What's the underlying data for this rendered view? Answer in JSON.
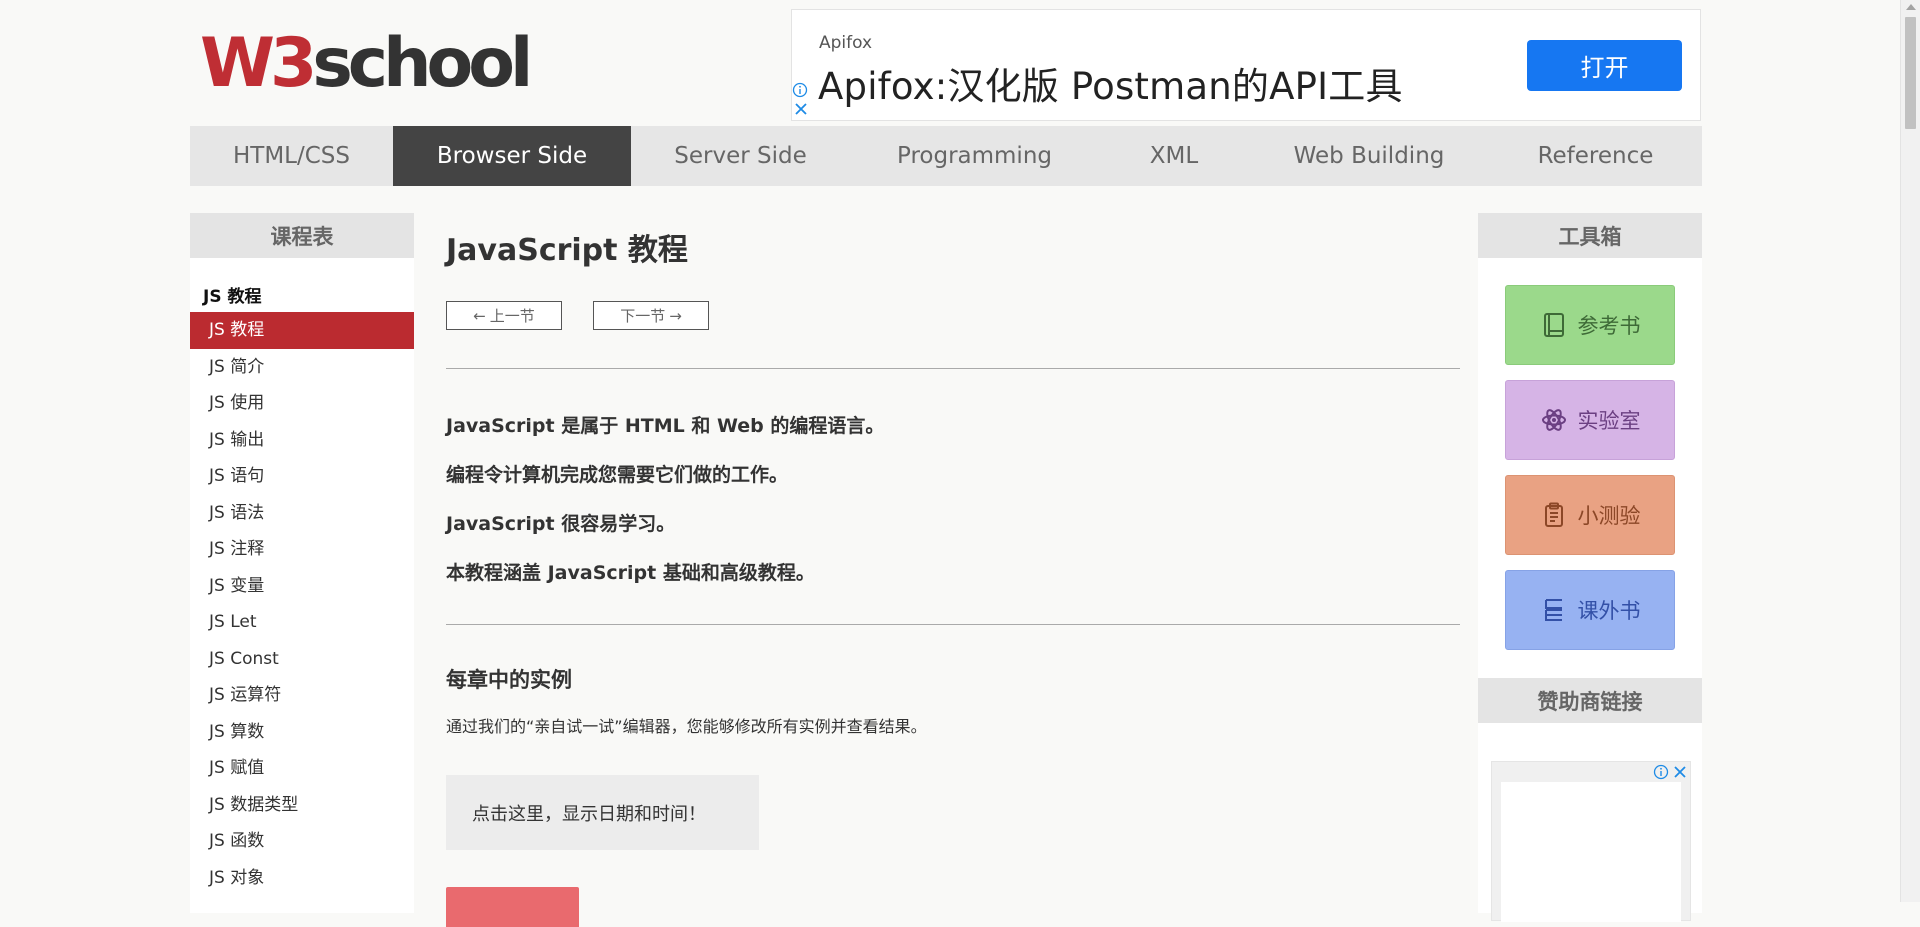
{
  "logo": {
    "text": "W3school",
    "colors": {
      "w3": "#bf2e34",
      "school": "#333333"
    }
  },
  "ad_top": {
    "brand": "Apifox",
    "headline": "Apifox:汉化版 Postman的API工具",
    "button": "打开",
    "icons": [
      "info-icon",
      "close-icon"
    ]
  },
  "nav": {
    "items": [
      {
        "label": "HTML/CSS",
        "active": false
      },
      {
        "label": "Browser Side",
        "active": true
      },
      {
        "label": "Server Side",
        "active": false
      },
      {
        "label": "Programming",
        "active": false
      },
      {
        "label": "XML",
        "active": false
      },
      {
        "label": "Web Building",
        "active": false
      },
      {
        "label": "Reference",
        "active": false
      }
    ]
  },
  "sidebar": {
    "title": "课程表",
    "section": "JS 教程",
    "items": [
      "JS 教程",
      "JS 简介",
      "JS 使用",
      "JS 输出",
      "JS 语句",
      "JS 语法",
      "JS 注释",
      "JS 变量",
      "JS Let",
      "JS Const",
      "JS 运算符",
      "JS 算数",
      "JS 赋值",
      "JS 数据类型",
      "JS 函数",
      "JS 对象"
    ],
    "active_index": 0
  },
  "main": {
    "title": "JavaScript 教程",
    "prev": "上一节",
    "next": "下一节",
    "intro": [
      "JavaScript 是属于 HTML 和 Web 的编程语言。",
      "编程令计算机完成您需要它们做的工作。",
      "JavaScript 很容易学习。",
      "本教程涵盖 JavaScript 基础和高级教程。"
    ],
    "examples_heading": "每章中的实例",
    "examples_desc": "通过我们的“亲自试一试”编辑器，您能够修改所有实例并查看结果。",
    "demo_text": "点击这里，显示日期和时间！"
  },
  "right": {
    "toolbox_title": "工具箱",
    "tools": [
      {
        "label": "参考书",
        "icon": "book-icon"
      },
      {
        "label": "实验室",
        "icon": "atom-icon"
      },
      {
        "label": "小测验",
        "icon": "clipboard-icon"
      },
      {
        "label": "课外书",
        "icon": "stack-icon"
      }
    ],
    "sponsor_title": "赞助商链接"
  },
  "colors": {
    "accent_red": "#bb2b30",
    "nav_active": "#444444",
    "open_button": "#1677f2"
  }
}
